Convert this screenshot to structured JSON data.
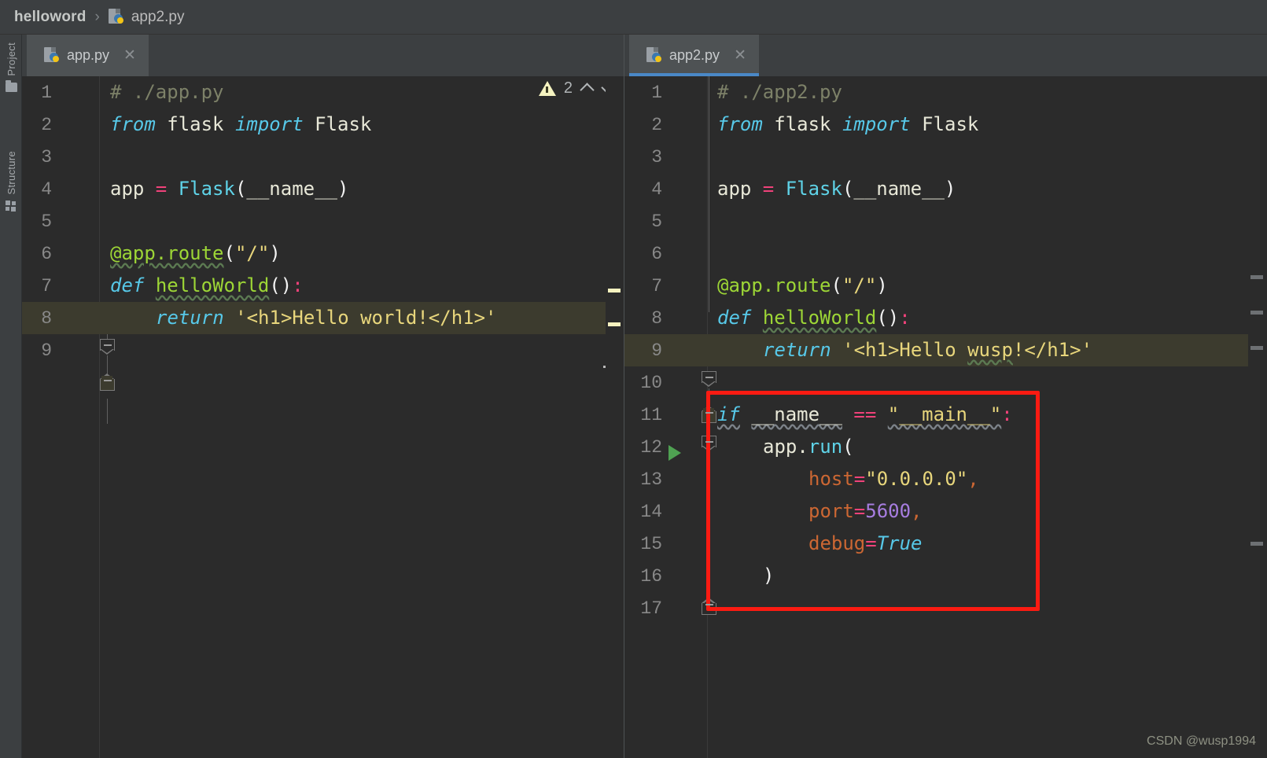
{
  "window": {
    "theme_bg": "#2b2b2b",
    "chrome_bg": "#3c3f41",
    "accent": "#4a88c7",
    "annotation_color": "#fb1b12"
  },
  "breadcrumb": {
    "project": "helloword",
    "separator": "›",
    "file": "app2.py",
    "file_icon": "python-file-icon"
  },
  "tool_sidebar": {
    "items": [
      {
        "label": "Project",
        "icon": "folder-icon"
      },
      {
        "label": "Structure",
        "icon": "structure-icon"
      }
    ]
  },
  "left_pane": {
    "tab": {
      "label": "app.py",
      "icon": "python-file-icon",
      "close": "✕",
      "active": false
    },
    "inspections": {
      "warning_icon": "warning-triangle-icon",
      "count": "2",
      "prev_icon": "chevron-up-icon",
      "next_icon": "chevron-down-icon"
    },
    "caret_line": 8,
    "lines": [
      {
        "n": "1",
        "tokens": [
          {
            "t": "# ./app.py",
            "c": "c-comment"
          }
        ]
      },
      {
        "n": "2",
        "tokens": [
          {
            "t": "from",
            "c": "c-kwi"
          },
          {
            "t": " flask ",
            "c": "c-plain"
          },
          {
            "t": "import",
            "c": "c-kwi"
          },
          {
            "t": " Flask",
            "c": "c-plain"
          }
        ]
      },
      {
        "n": "3",
        "tokens": []
      },
      {
        "n": "4",
        "tokens": [
          {
            "t": "app ",
            "c": "c-plain"
          },
          {
            "t": "=",
            "c": "c-op"
          },
          {
            "t": " ",
            "c": "c-plain"
          },
          {
            "t": "Flask",
            "c": "c-cls"
          },
          {
            "t": "(",
            "c": "c-paren"
          },
          {
            "t": "__name__",
            "c": "c-plain"
          },
          {
            "t": ")",
            "c": "c-paren"
          }
        ]
      },
      {
        "n": "5",
        "tokens": []
      },
      {
        "n": "6",
        "tokens": [
          {
            "t": "@app.route",
            "c": "c-deco squig"
          },
          {
            "t": "(",
            "c": "c-paren"
          },
          {
            "t": "\"/\"",
            "c": "c-str"
          },
          {
            "t": ")",
            "c": "c-paren"
          }
        ]
      },
      {
        "n": "7",
        "tokens": [
          {
            "t": "def",
            "c": "c-kwi"
          },
          {
            "t": " ",
            "c": "c-plain"
          },
          {
            "t": "helloWorld",
            "c": "c-fn squig"
          },
          {
            "t": "()",
            "c": "c-paren"
          },
          {
            "t": ":",
            "c": "c-colon"
          }
        ]
      },
      {
        "n": "8",
        "indent": 1,
        "tokens": [
          {
            "t": "return",
            "c": "c-kwi"
          },
          {
            "t": " ",
            "c": "c-plain"
          },
          {
            "t": "'<h1>Hello world!</h1>'",
            "c": "c-str"
          }
        ]
      },
      {
        "n": "9",
        "tokens": []
      }
    ]
  },
  "right_pane": {
    "tab": {
      "label": "app2.py",
      "icon": "python-file-icon",
      "close": "✕",
      "active": true
    },
    "caret_line": 9,
    "run_marker_line": 11,
    "intention_bulb_line": 9,
    "lines": [
      {
        "n": "1",
        "tokens": [
          {
            "t": "# ./app2.py",
            "c": "c-comment"
          }
        ]
      },
      {
        "n": "2",
        "tokens": [
          {
            "t": "from",
            "c": "c-kwi"
          },
          {
            "t": " flask ",
            "c": "c-plain"
          },
          {
            "t": "import",
            "c": "c-kwi"
          },
          {
            "t": " Flask",
            "c": "c-plain"
          }
        ]
      },
      {
        "n": "3",
        "tokens": []
      },
      {
        "n": "4",
        "tokens": [
          {
            "t": "app ",
            "c": "c-plain"
          },
          {
            "t": "=",
            "c": "c-op"
          },
          {
            "t": " ",
            "c": "c-plain"
          },
          {
            "t": "Flask",
            "c": "c-cls"
          },
          {
            "t": "(",
            "c": "c-paren"
          },
          {
            "t": "__name__",
            "c": "c-plain"
          },
          {
            "t": ")",
            "c": "c-paren"
          }
        ]
      },
      {
        "n": "5",
        "tokens": []
      },
      {
        "n": "6",
        "tokens": []
      },
      {
        "n": "7",
        "tokens": [
          {
            "t": "@app.route",
            "c": "c-deco"
          },
          {
            "t": "(",
            "c": "c-paren"
          },
          {
            "t": "\"/\"",
            "c": "c-str"
          },
          {
            "t": ")",
            "c": "c-paren"
          }
        ]
      },
      {
        "n": "8",
        "tokens": [
          {
            "t": "def",
            "c": "c-kwi"
          },
          {
            "t": " ",
            "c": "c-plain"
          },
          {
            "t": "helloWorld",
            "c": "c-fn squig"
          },
          {
            "t": "()",
            "c": "c-paren"
          },
          {
            "t": ":",
            "c": "c-colon"
          }
        ]
      },
      {
        "n": "9",
        "indent": 1,
        "tokens": [
          {
            "t": "return",
            "c": "c-kwi"
          },
          {
            "t": " ",
            "c": "c-plain"
          },
          {
            "t": "'<h1>Hello ",
            "c": "c-str"
          },
          {
            "t": "wusp",
            "c": "c-str squig"
          },
          {
            "t": "!</h1>'",
            "c": "c-str"
          }
        ]
      },
      {
        "n": "10",
        "tokens": []
      },
      {
        "n": "11",
        "tokens": [
          {
            "t": "if",
            "c": "c-kwi squig-grey"
          },
          {
            "t": " ",
            "c": "c-plain"
          },
          {
            "t": "__name__",
            "c": "c-plain squig-grey"
          },
          {
            "t": " ",
            "c": "c-plain"
          },
          {
            "t": "==",
            "c": "c-op"
          },
          {
            "t": " ",
            "c": "c-plain"
          },
          {
            "t": "\"__main__\"",
            "c": "c-str squig-grey"
          },
          {
            "t": ":",
            "c": "c-colon"
          }
        ]
      },
      {
        "n": "12",
        "indent": 1,
        "tokens": [
          {
            "t": "app.",
            "c": "c-plain"
          },
          {
            "t": "run",
            "c": "c-method"
          },
          {
            "t": "(",
            "c": "c-paren"
          }
        ]
      },
      {
        "n": "13",
        "indent": 2,
        "tokens": [
          {
            "t": "host",
            "c": "c-kwarg"
          },
          {
            "t": "=",
            "c": "c-op"
          },
          {
            "t": "\"0.0.0.0\"",
            "c": "c-str"
          },
          {
            "t": ",",
            "c": "c-kwarg"
          }
        ]
      },
      {
        "n": "14",
        "indent": 2,
        "tokens": [
          {
            "t": "port",
            "c": "c-kwarg"
          },
          {
            "t": "=",
            "c": "c-op"
          },
          {
            "t": "5600",
            "c": "c-num"
          },
          {
            "t": ",",
            "c": "c-kwarg"
          }
        ]
      },
      {
        "n": "15",
        "indent": 2,
        "tokens": [
          {
            "t": "debug",
            "c": "c-kwarg"
          },
          {
            "t": "=",
            "c": "c-op"
          },
          {
            "t": "True",
            "c": "c-kwi"
          }
        ]
      },
      {
        "n": "16",
        "indent": 1,
        "tokens": [
          {
            "t": ")",
            "c": "c-paren"
          }
        ]
      },
      {
        "n": "17",
        "tokens": []
      }
    ]
  },
  "annotation": {
    "name": "red-highlight-box",
    "covers_lines": "11-17"
  },
  "watermark": "CSDN @wusp1994"
}
